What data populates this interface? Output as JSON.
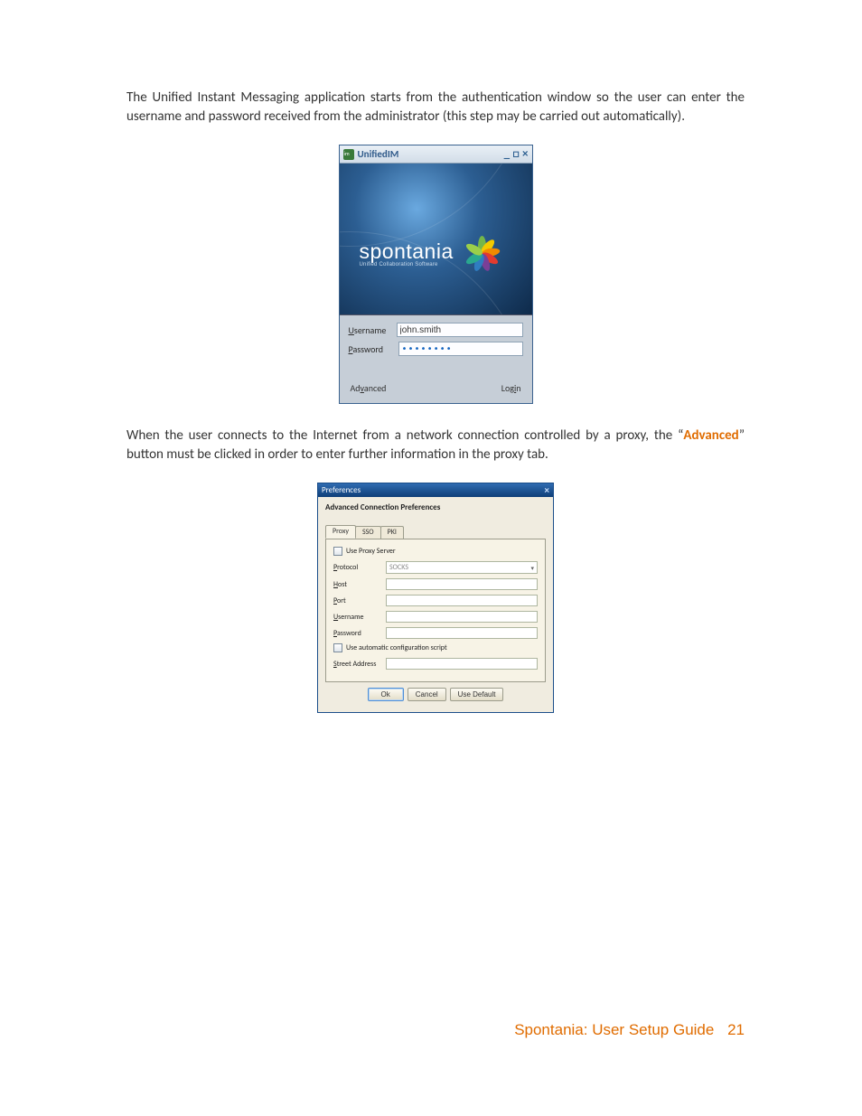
{
  "paragraphs": {
    "p1": "The Unified Instant Messaging application starts from the authentication window so the user can enter the username and password received from the administrator (this step may be carried out automatically).",
    "p2_pre": "When the user connects to the Internet from a network connection controlled by a proxy, the “",
    "p2_strong": "Advanced",
    "p2_post": "” button must be clicked in order to enter further information in the proxy tab."
  },
  "login": {
    "title": "UnifiedIM",
    "splash_brand": "spontania",
    "splash_sub": "Unified Collaboration Software",
    "username_label": "Username",
    "username_hotkey": "U",
    "username_value": "john.smith",
    "password_label": "Password",
    "password_hotkey": "P",
    "password_value": "••••••••",
    "advanced_label": "Advanced",
    "advanced_hotkey": "v",
    "login_label": "Login",
    "login_hotkey": "i"
  },
  "prefs": {
    "title": "Preferences",
    "section": "Advanced Connection Preferences",
    "tabs": {
      "proxy": "Proxy",
      "sso": "SSO",
      "pki": "PKI"
    },
    "use_proxy": "Use Proxy Server",
    "protocol_label": "Protocol",
    "protocol_value": "SOCKS",
    "host_label": "Host",
    "port_label": "Port",
    "username_label": "Username",
    "password_label": "Password",
    "auto_script": "Use automatic configuration script",
    "street_label": "Street Address",
    "buttons": {
      "ok": "Ok",
      "cancel": "Cancel",
      "default": "Use Default"
    }
  },
  "footer": {
    "title": "Spontania: User Setup Guide",
    "page": "21"
  }
}
